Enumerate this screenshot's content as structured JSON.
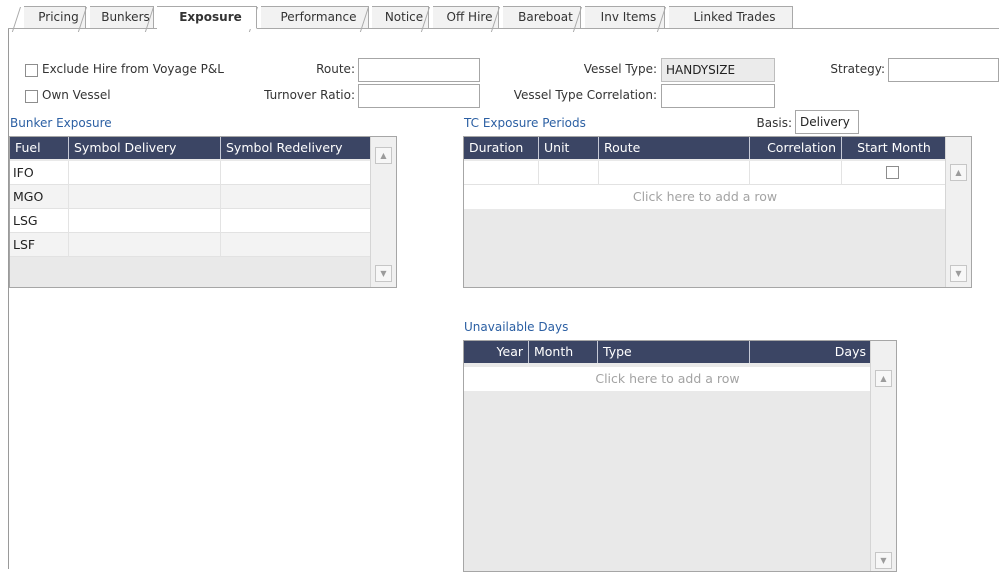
{
  "tabs": [
    {
      "label": "Pricing",
      "active": false
    },
    {
      "label": "Bunkers",
      "active": false
    },
    {
      "label": "Exposure",
      "active": true
    },
    {
      "label": "Performance",
      "active": false
    },
    {
      "label": "Notice",
      "active": false
    },
    {
      "label": "Off Hire",
      "active": false
    },
    {
      "label": "Bareboat",
      "active": false
    },
    {
      "label": "Inv Items",
      "active": false
    },
    {
      "label": "Linked Trades",
      "active": false
    }
  ],
  "form": {
    "exclude_hire_label": "Exclude Hire from Voyage P&L",
    "own_vessel_label": "Own Vessel",
    "route_label": "Route:",
    "route_value": "",
    "turnover_ratio_label": "Turnover Ratio:",
    "turnover_ratio_value": "",
    "vessel_type_label": "Vessel Type:",
    "vessel_type_value": "HANDYSIZE",
    "vessel_type_correlation_label": "Vessel Type Correlation:",
    "vessel_type_correlation_value": "",
    "strategy_label": "Strategy:",
    "strategy_value": ""
  },
  "bunker_exposure": {
    "title": "Bunker Exposure",
    "columns": [
      "Fuel",
      "Symbol Delivery",
      "Symbol Redelivery"
    ],
    "rows": [
      [
        "IFO",
        "",
        ""
      ],
      [
        "MGO",
        "",
        ""
      ],
      [
        "LSG",
        "",
        ""
      ],
      [
        "LSF",
        "",
        ""
      ]
    ]
  },
  "tc_exposure": {
    "title": "TC Exposure Periods",
    "basis_label": "Basis:",
    "basis_value": "Delivery",
    "columns": [
      "Duration",
      "Unit",
      "Route",
      "Correlation",
      "Start Month"
    ],
    "add_row_text": "Click here to add a row"
  },
  "unavailable_days": {
    "title": "Unavailable Days",
    "columns": [
      "Year",
      "Month",
      "Type",
      "Days"
    ],
    "add_row_text": "Click here to add a row"
  },
  "icons": {
    "scroll_up": "scroll-up-arrow-icon",
    "scroll_down": "scroll-down-arrow-icon"
  },
  "colors": {
    "grid_header": "#3b4564",
    "section_title": "#2b5fa3",
    "grid_body": "#e9e9e9"
  }
}
